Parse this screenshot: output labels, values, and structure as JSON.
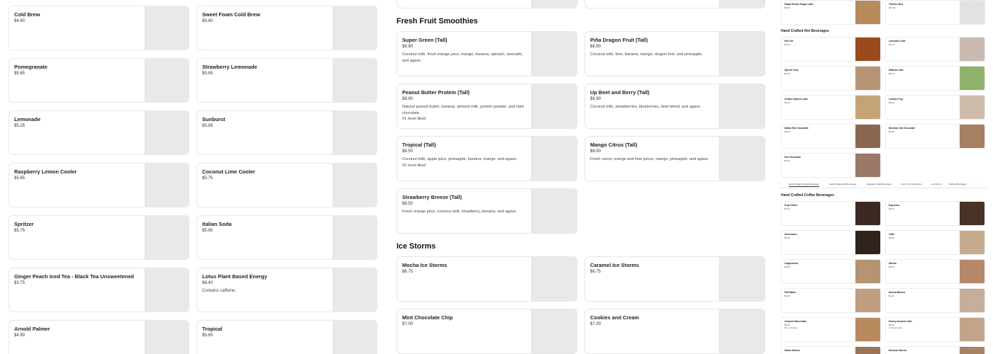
{
  "col1": [
    {
      "name": "Cold Brew",
      "price": "$4.60"
    },
    {
      "name": "Pomegranate",
      "price": "$5.65"
    },
    {
      "name": "Lemonade",
      "price": "$5.25"
    },
    {
      "name": "Raspberry Lemon Cooler",
      "price": "$5.65"
    },
    {
      "name": "Spritzer",
      "price": "$5.75"
    },
    {
      "name": "Ginger Peach Iced Tea - Black Tea Unsweetened",
      "price": "$3.75"
    },
    {
      "name": "Arnold Palmer",
      "price": "$4.90"
    }
  ],
  "col2": [
    {
      "name": "Sweet Foam Cold Brew",
      "price": "$5.60",
      "note": ""
    },
    {
      "name": "Strawberry Lemonade",
      "price": "$5.65",
      "note": ""
    },
    {
      "name": "Sunburst",
      "price": "$5.65",
      "note": ""
    },
    {
      "name": "Coconut Lime Cooler",
      "price": "$5.75",
      "note": ""
    },
    {
      "name": "Italian Soda",
      "price": "$5.65",
      "note": ""
    },
    {
      "name": "Lotus Plant Based Energy",
      "price": "$6.40",
      "note": "Contains caffeine."
    },
    {
      "name": "Tropical",
      "price": "$5.65",
      "note": ""
    }
  ],
  "smoothies": {
    "title": "Fresh Fruit Smoothies",
    "items": [
      {
        "name": "Super Green (Tall)",
        "price": "$8.90",
        "desc": "Coconut milk, fresh orange juice, mango, banana, spinach, avocado, and agave.",
        "extra": ""
      },
      {
        "name": "Piña Dragon Fruit (Tall)",
        "price": "$8.90",
        "desc": "Coconut milk, lime, banana, mango, dragon fruit, and pineapple.",
        "extra": ""
      },
      {
        "name": "Peanut Butter Protein (Tall)",
        "price": "$8.90",
        "desc": "Natural peanut butter, banana, almond milk, protein powder, and dark chocolate.",
        "extra": "#1 most liked"
      },
      {
        "name": "Up Beet and Berry (Tall)",
        "price": "$8.90",
        "desc": "Coconut milk, strawberries, blueberries, beet blend, and agave.",
        "extra": ""
      },
      {
        "name": "Tropical (Tall)",
        "price": "$8.50",
        "desc": "Coconut milk, apple juice, pineapple, banana, mango, and agave.",
        "extra": "#2 most liked"
      },
      {
        "name": "Mango Citrus (Tall)",
        "price": "$8.50",
        "desc": "Fresh carrot, orange and lime juices, mango, pineapple, and agave.",
        "extra": ""
      },
      {
        "name": "Strawberry Breeze (Tall)",
        "price": "$8.50",
        "desc": "Fresh orange juice, coconut milk, strawberry, banana, and agave.",
        "extra": ""
      }
    ]
  },
  "icestorms": {
    "title": "Ice Storms",
    "items": [
      {
        "name": "Mocha Ice Storms",
        "price": "$6.75"
      },
      {
        "name": "Caramel Ice Storms",
        "price": "$6.75"
      },
      {
        "name": "Mint Chocolate Chip",
        "price": "$7.00"
      },
      {
        "name": "Cookies and Cream",
        "price": "$7.00"
      }
    ]
  },
  "mini": {
    "top": [
      {
        "name": "Maple Brown Sugar Latte",
        "price": "$6.00",
        "note": "",
        "color": "#b98a5a"
      },
      {
        "name": "Traveler Box",
        "price": "$22.00",
        "note": "",
        "color": "#d9d9d9"
      }
    ],
    "hot_title": "Hand Crafted Hot Beverages",
    "hot": [
      {
        "name": "Hot Tea",
        "price": "$3.60",
        "note": "",
        "color": "#9a4a1c"
      },
      {
        "name": "Lavender Chai",
        "price": "$5.75",
        "note": "",
        "color": "#c9b9b0"
      },
      {
        "name": "Spiced Chai",
        "price": "$5.50",
        "note": "",
        "color": "#b89477"
      },
      {
        "name": "Matcha Latte",
        "price": "$6.00",
        "note": "",
        "color": "#8fb26a"
      },
      {
        "name": "Golden Spiced Latte",
        "price": "$6.00",
        "note": "",
        "color": "#c4a474"
      },
      {
        "name": "London Fog",
        "price": "$5.50",
        "note": "",
        "color": "#cdbcaa"
      },
      {
        "name": "Italian Hot Chocolate",
        "price": "$6.00",
        "note": "",
        "color": "#8b6752"
      },
      {
        "name": "Mexican Hot Chocolate",
        "price": "$6.00",
        "note": "",
        "color": "#a77f63"
      },
      {
        "name": "Hot Chocolate",
        "price": "$4.50",
        "note": "",
        "color": "#9b7966"
      }
    ],
    "tabs": [
      "Hand Crafted Coffee Beverages",
      "Hand Crafted Hot Beverages",
      "Signature Cold Beverages",
      "Fresh Fruit Smoothies",
      "Ice Storms",
      "Bottled Beverages"
    ],
    "coffee_title": "Hand Crafted Coffee Beverages",
    "coffee": [
      {
        "name": "Drip Coffee",
        "price": "$3.25",
        "note": "",
        "color": "#3a2a22"
      },
      {
        "name": "Espresso",
        "price": "$3.50",
        "note": "",
        "color": "#4a3326"
      },
      {
        "name": "Americano",
        "price": "$3.50",
        "note": "",
        "color": "#2f231c"
      },
      {
        "name": "Latte",
        "price": "$6.00",
        "note": "",
        "color": "#c7ab8e"
      },
      {
        "name": "Cappuccino",
        "price": "$5.00",
        "note": "",
        "color": "#b59373"
      },
      {
        "name": "Mocha",
        "price": "$6.00",
        "note": "",
        "color": "#b7886a"
      },
      {
        "name": "Flat White",
        "price": "$6.00",
        "note": "",
        "color": "#c09e80"
      },
      {
        "name": "Mocha Blanco",
        "price": "$6.00",
        "note": "",
        "color": "#c6ae9a"
      },
      {
        "name": "Caramel Macchiato",
        "price": "$6.00",
        "note": "#3 most liked",
        "color": "#b88a5e"
      },
      {
        "name": "Honey Almond Latte",
        "price": "$6.00",
        "note": "Contains Nuts",
        "color": "#c2a588"
      },
      {
        "name": "Italian Mocha",
        "price": "",
        "note": "",
        "color": "#9a7358"
      },
      {
        "name": "Mexican Mocha",
        "price": "",
        "note": "",
        "color": "#a98266"
      }
    ]
  }
}
